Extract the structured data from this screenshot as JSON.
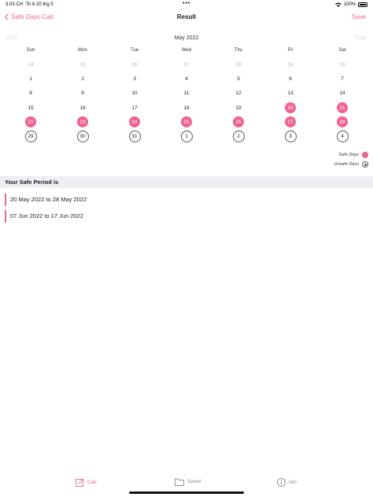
{
  "status_bar": {
    "time": "3:03 CH",
    "date": "Th 6 20 thg 5",
    "battery": "100%"
  },
  "nav": {
    "back_label": "Safe Days Calc",
    "title": "Result",
    "save_label": "Save"
  },
  "calendar": {
    "prev_label": "2022",
    "month_title": "May 2022",
    "next_label": "June",
    "weekdays": [
      "Sun",
      "Mon",
      "Tue",
      "Wed",
      "Thu",
      "Fri",
      "Sat"
    ],
    "days": [
      {
        "d": "24",
        "t": "out"
      },
      {
        "d": "25",
        "t": "out"
      },
      {
        "d": "26",
        "t": "out"
      },
      {
        "d": "27",
        "t": "out"
      },
      {
        "d": "28",
        "t": "out"
      },
      {
        "d": "29",
        "t": "out"
      },
      {
        "d": "30",
        "t": "out"
      },
      {
        "d": "1",
        "t": "n"
      },
      {
        "d": "2",
        "t": "n"
      },
      {
        "d": "3",
        "t": "n"
      },
      {
        "d": "4",
        "t": "n"
      },
      {
        "d": "5",
        "t": "n"
      },
      {
        "d": "6",
        "t": "n"
      },
      {
        "d": "7",
        "t": "n"
      },
      {
        "d": "8",
        "t": "n"
      },
      {
        "d": "9",
        "t": "n"
      },
      {
        "d": "10",
        "t": "n"
      },
      {
        "d": "11",
        "t": "n"
      },
      {
        "d": "12",
        "t": "n"
      },
      {
        "d": "13",
        "t": "n"
      },
      {
        "d": "14",
        "t": "n"
      },
      {
        "d": "15",
        "t": "n"
      },
      {
        "d": "16",
        "t": "n"
      },
      {
        "d": "17",
        "t": "n"
      },
      {
        "d": "18",
        "t": "n"
      },
      {
        "d": "19",
        "t": "n"
      },
      {
        "d": "20",
        "t": "safe"
      },
      {
        "d": "21",
        "t": "safe"
      },
      {
        "d": "22",
        "t": "safe"
      },
      {
        "d": "23",
        "t": "safe"
      },
      {
        "d": "24",
        "t": "safe"
      },
      {
        "d": "25",
        "t": "safe"
      },
      {
        "d": "26",
        "t": "safe"
      },
      {
        "d": "27",
        "t": "safe"
      },
      {
        "d": "28",
        "t": "safe"
      },
      {
        "d": "29",
        "t": "unsafe"
      },
      {
        "d": "30",
        "t": "unsafe"
      },
      {
        "d": "31",
        "t": "unsafe"
      },
      {
        "d": "1",
        "t": "unsafe"
      },
      {
        "d": "2",
        "t": "unsafe"
      },
      {
        "d": "3",
        "t": "unsafe"
      },
      {
        "d": "4",
        "t": "unsafe"
      }
    ]
  },
  "legend": {
    "safe_label": "Safe Days",
    "unsafe_label": "Unsafe Days"
  },
  "section": {
    "title": "Your Safe Period is"
  },
  "periods": [
    "20 May 2022 to 28 May 2022",
    "07 Jun 2022 to 17 Jun 2022"
  ],
  "tabs": [
    {
      "label": "Calc",
      "icon": "edit-icon",
      "active": true
    },
    {
      "label": "Saved",
      "icon": "folder-icon",
      "active": false
    },
    {
      "label": "Info",
      "icon": "info-icon",
      "active": false
    }
  ],
  "colors": {
    "accent": "#f06292",
    "section_bg": "#eeeef4"
  }
}
